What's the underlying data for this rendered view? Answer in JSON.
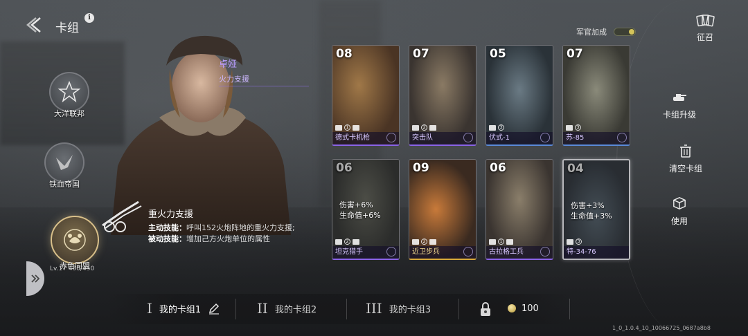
{
  "header": {
    "title": "卡组",
    "info": "i"
  },
  "factions": [
    {
      "label": "大洋联邦",
      "active": false
    },
    {
      "label": "铁血帝国",
      "active": false
    },
    {
      "label": "赤色同盟",
      "active": true
    }
  ],
  "level": "Lv.17  400/450",
  "commander": {
    "name": "卓娅",
    "role": "火力支援",
    "skill_name": "重火力支援",
    "active_label": "主动技能：",
    "active_text": "呼叫152火炮阵地的重火力支援;",
    "passive_label": "被动技能：",
    "passive_text": "增加己方火炮单位的属性"
  },
  "officer_bonus": {
    "label": "军官加成",
    "on": true
  },
  "recruit": {
    "label": "征召"
  },
  "cards": [
    {
      "cost": "08",
      "name": "德式卡机枪",
      "icon_num": "1",
      "stats": [],
      "rarity": "purple",
      "dim": false,
      "frosted": false
    },
    {
      "cost": "07",
      "name": "突击队",
      "icon_num": "2",
      "stats": [],
      "rarity": "purple",
      "dim": false,
      "frosted": false
    },
    {
      "cost": "05",
      "name": "伏式-1",
      "icon_num": "3",
      "stats": [],
      "rarity": "blue",
      "dim": false,
      "frosted": false
    },
    {
      "cost": "07",
      "name": "苏-85",
      "icon_num": "3",
      "stats": [],
      "rarity": "blue",
      "dim": false,
      "frosted": false
    },
    {
      "cost": "06",
      "name": "坦克猎手",
      "icon_num": "2",
      "stats": [
        "伤害+6%",
        "生命值+6%"
      ],
      "rarity": "purple",
      "dim": true,
      "frosted": false
    },
    {
      "cost": "09",
      "name": "近卫步兵",
      "icon_num": "2",
      "stats": [],
      "rarity": "gold",
      "dim": false,
      "frosted": false
    },
    {
      "cost": "06",
      "name": "古拉格工兵",
      "icon_num": "1",
      "stats": [],
      "rarity": "purple",
      "dim": false,
      "frosted": false
    },
    {
      "cost": "04",
      "name": "特-34-76",
      "icon_num": "3",
      "stats": [
        "伤害+3%",
        "生命值+3%"
      ],
      "rarity": "blue",
      "dim": true,
      "frosted": true
    }
  ],
  "actions": [
    {
      "label": "卡组升级",
      "icon": "tank-upgrade-icon"
    },
    {
      "label": "清空卡组",
      "icon": "trash-icon"
    },
    {
      "label": "使用",
      "icon": "cube-icon"
    }
  ],
  "decks": [
    {
      "roman": "I",
      "label": "我的卡组1",
      "active": true
    },
    {
      "roman": "II",
      "label": "我的卡组2",
      "active": false
    },
    {
      "roman": "III",
      "label": "我的卡组3",
      "active": false
    }
  ],
  "currency": {
    "value": "100"
  },
  "version": "1_0_1.0.4_10_10066725_0687a8b8",
  "colors": {
    "accent_purple": "#8a63e8",
    "accent_gold": "#d9a93a",
    "accent_blue": "#5a8ad9"
  }
}
